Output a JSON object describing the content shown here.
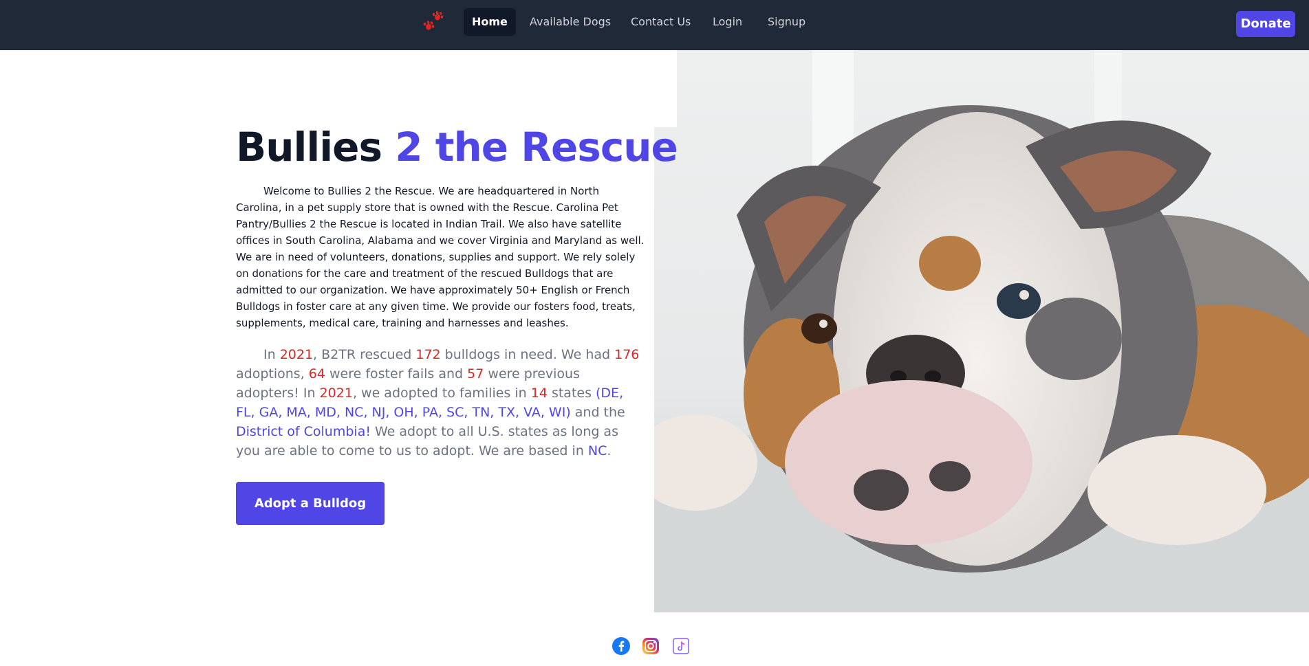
{
  "nav": {
    "logo_icon": "paw-icon",
    "links": [
      {
        "label": "Home",
        "active": true
      },
      {
        "label": "Available Dogs",
        "active": false
      },
      {
        "label": "Contact Us",
        "active": false
      },
      {
        "label": "Login",
        "active": false
      },
      {
        "label": "Signup",
        "active": false
      }
    ],
    "donate_label": "Donate"
  },
  "hero": {
    "title_part1": "Bullies ",
    "title_part2": "2 the Rescue",
    "intro": "Welcome to Bullies 2 the Rescue. We are headquartered in North Carolina, in a pet supply store that is owned with the Rescue. Carolina Pet Pantry/Bullies 2 the Rescue is located in Indian Trail. We also have satellite offices in South Carolina, Alabama and we cover Virginia and Maryland as well. We are in need of volunteers, donations, supplies and support. We rely solely on donations for the care and treatment of the rescued Bulldogs that are admitted to our organization. We have approximately 50+ English or French Bulldogs in foster care at any given time. We provide our fosters food, treats, supplements, medical care, training and harnesses and leashes.",
    "stats": {
      "t1": "In ",
      "year": "2021",
      "t2": ", B2TR rescued ",
      "rescued": "172",
      "t3": " bulldogs in need. We had ",
      "adoptions": "176",
      "t4": " adoptions, ",
      "foster_fails": "64",
      "t5": " were foster fails and ",
      "previous": "57",
      "t6": " were previous adopters! In ",
      "year2": "2021",
      "t7": ", we adopted to families in ",
      "states_count": "14",
      "t8": " states ",
      "states_list": "(DE, FL, GA, MA, MD, NC, NJ, OH, PA, SC, TN, TX, VA, WI)",
      "t9": " and the ",
      "dc": "District of Columbia!",
      "t10": " We adopt to all U.S. states as long as you are able to come to us to adopt. We are based in ",
      "base": "NC",
      "t11": "."
    },
    "cta_label": "Adopt a Bulldog",
    "photo_icon": "bulldog-photo"
  },
  "footer": {
    "social": [
      {
        "icon": "facebook-icon",
        "color": "#1877f2"
      },
      {
        "icon": "instagram-icon",
        "color": "#e1306c"
      },
      {
        "icon": "tiktok-icon",
        "color": "#8b5cf6"
      }
    ]
  },
  "colors": {
    "nav_bg": "#1f2937",
    "accent": "#4f46e5",
    "highlight_red": "#dc2626",
    "text_muted": "#6b7280"
  }
}
